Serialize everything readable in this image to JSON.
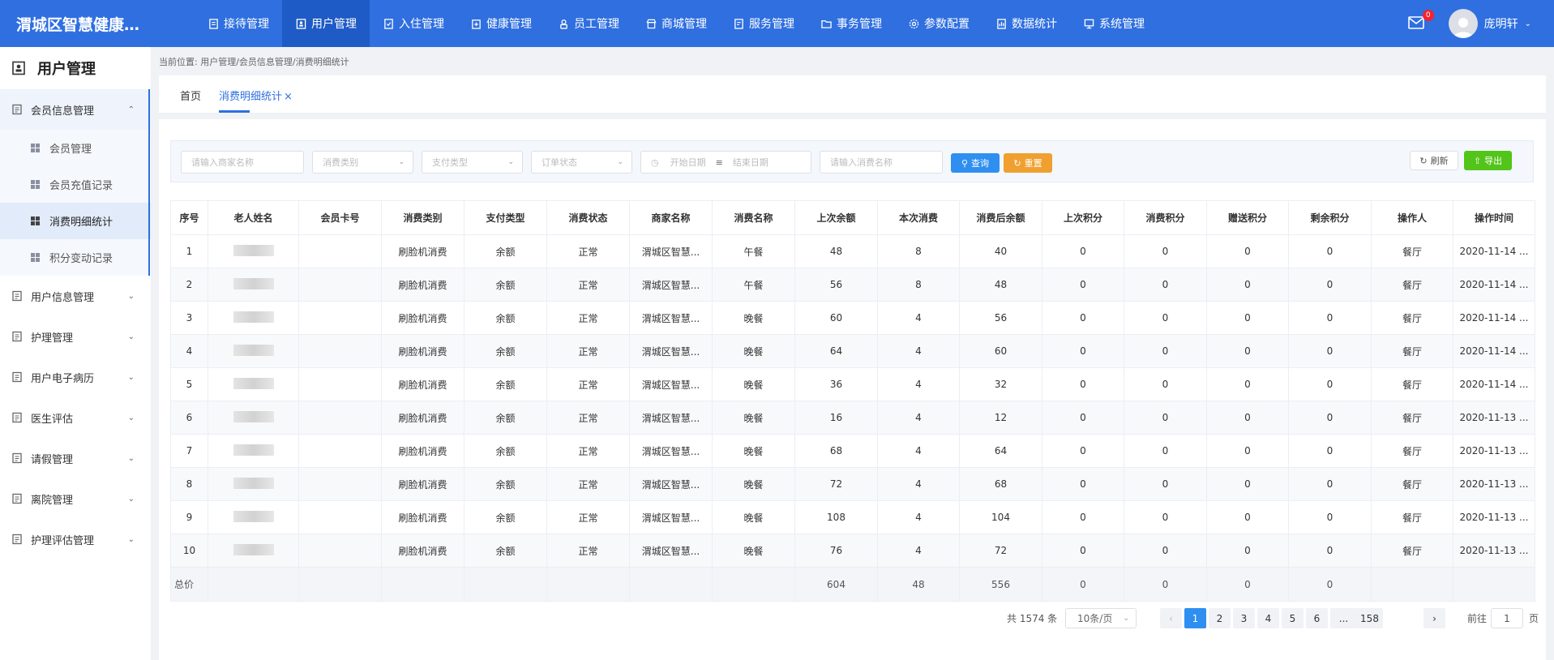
{
  "app": {
    "title": "渭城区智慧健康…"
  },
  "nav": [
    {
      "label": "接待管理",
      "icon": "reception-icon",
      "active": false
    },
    {
      "label": "用户管理",
      "icon": "user-manage-icon",
      "active": true
    },
    {
      "label": "入住管理",
      "icon": "checkin-icon",
      "active": false
    },
    {
      "label": "健康管理",
      "icon": "health-icon",
      "active": false
    },
    {
      "label": "员工管理",
      "icon": "staff-icon",
      "active": false
    },
    {
      "label": "商城管理",
      "icon": "shop-icon",
      "active": false
    },
    {
      "label": "服务管理",
      "icon": "service-icon",
      "active": false
    },
    {
      "label": "事务管理",
      "icon": "folder-icon",
      "active": false
    },
    {
      "label": "参数配置",
      "icon": "config-icon",
      "active": false
    },
    {
      "label": "数据统计",
      "icon": "stats-icon",
      "active": false
    },
    {
      "label": "系统管理",
      "icon": "system-icon",
      "active": false
    }
  ],
  "user": {
    "name": "庞明轩",
    "mail_count": "0"
  },
  "sidebar": {
    "title": "用户管理",
    "groups": [
      {
        "label": "会员信息管理",
        "open": true,
        "items": [
          {
            "label": "会员管理",
            "active": false
          },
          {
            "label": "会员充值记录",
            "active": false
          },
          {
            "label": "消费明细统计",
            "active": true
          },
          {
            "label": "积分变动记录",
            "active": false
          }
        ]
      },
      {
        "label": "用户信息管理",
        "open": false,
        "items": []
      },
      {
        "label": "护理管理",
        "open": false,
        "items": []
      },
      {
        "label": "用户电子病历",
        "open": false,
        "items": []
      },
      {
        "label": "医生评估",
        "open": false,
        "items": []
      },
      {
        "label": "请假管理",
        "open": false,
        "items": []
      },
      {
        "label": "离院管理",
        "open": false,
        "items": []
      },
      {
        "label": "护理评估管理",
        "open": false,
        "items": []
      }
    ]
  },
  "breadcrumb": "当前位置: 用户管理/会员信息管理/消费明细统计",
  "tabs": {
    "home": "首页",
    "current": "消费明细统计"
  },
  "filters": {
    "merchant_placeholder": "请输入商家名称",
    "category_placeholder": "消费类别",
    "pay_type_placeholder": "支付类型",
    "order_status_placeholder": "订单状态",
    "start_date_placeholder": "开始日期",
    "end_date_placeholder": "结束日期",
    "consume_name_placeholder": "请输入消费名称",
    "query_label": "查询",
    "reset_label": "重置",
    "refresh_label": "刷新",
    "export_label": "导出"
  },
  "table": {
    "columns": [
      "序号",
      "老人姓名",
      "会员卡号",
      "消费类别",
      "支付类型",
      "消费状态",
      "商家名称",
      "消费名称",
      "上次余额",
      "本次消费",
      "消费后余额",
      "上次积分",
      "消费积分",
      "赠送积分",
      "剩余积分",
      "操作人",
      "操作时间"
    ],
    "rows": [
      [
        "1",
        "",
        "",
        "刷脸机消费",
        "余额",
        "正常",
        "渭城区智慧...",
        "午餐",
        "48",
        "8",
        "40",
        "0",
        "0",
        "0",
        "0",
        "餐厅",
        "2020-11-14 ..."
      ],
      [
        "2",
        "",
        "",
        "刷脸机消费",
        "余额",
        "正常",
        "渭城区智慧...",
        "午餐",
        "56",
        "8",
        "48",
        "0",
        "0",
        "0",
        "0",
        "餐厅",
        "2020-11-14 ..."
      ],
      [
        "3",
        "",
        "",
        "刷脸机消费",
        "余额",
        "正常",
        "渭城区智慧...",
        "晚餐",
        "60",
        "4",
        "56",
        "0",
        "0",
        "0",
        "0",
        "餐厅",
        "2020-11-14 ..."
      ],
      [
        "4",
        "",
        "",
        "刷脸机消费",
        "余额",
        "正常",
        "渭城区智慧...",
        "晚餐",
        "64",
        "4",
        "60",
        "0",
        "0",
        "0",
        "0",
        "餐厅",
        "2020-11-14 ..."
      ],
      [
        "5",
        "",
        "",
        "刷脸机消费",
        "余额",
        "正常",
        "渭城区智慧...",
        "晚餐",
        "36",
        "4",
        "32",
        "0",
        "0",
        "0",
        "0",
        "餐厅",
        "2020-11-14 ..."
      ],
      [
        "6",
        "",
        "",
        "刷脸机消费",
        "余额",
        "正常",
        "渭城区智慧...",
        "晚餐",
        "16",
        "4",
        "12",
        "0",
        "0",
        "0",
        "0",
        "餐厅",
        "2020-11-13 ..."
      ],
      [
        "7",
        "",
        "",
        "刷脸机消费",
        "余额",
        "正常",
        "渭城区智慧...",
        "晚餐",
        "68",
        "4",
        "64",
        "0",
        "0",
        "0",
        "0",
        "餐厅",
        "2020-11-13 ..."
      ],
      [
        "8",
        "",
        "",
        "刷脸机消费",
        "余额",
        "正常",
        "渭城区智慧...",
        "晚餐",
        "72",
        "4",
        "68",
        "0",
        "0",
        "0",
        "0",
        "餐厅",
        "2020-11-13 ..."
      ],
      [
        "9",
        "",
        "",
        "刷脸机消费",
        "余额",
        "正常",
        "渭城区智慧...",
        "晚餐",
        "108",
        "4",
        "104",
        "0",
        "0",
        "0",
        "0",
        "餐厅",
        "2020-11-13 ..."
      ],
      [
        "10",
        "",
        "",
        "刷脸机消费",
        "余额",
        "正常",
        "渭城区智慧...",
        "晚餐",
        "76",
        "4",
        "72",
        "0",
        "0",
        "0",
        "0",
        "餐厅",
        "2020-11-13 ..."
      ]
    ],
    "summary": [
      "总价",
      "",
      "",
      "",
      "",
      "",
      "",
      "",
      "604",
      "48",
      "556",
      "0",
      "0",
      "0",
      "0",
      "",
      ""
    ]
  },
  "pagination": {
    "total_text": "共 1574 条",
    "page_size": "10条/页",
    "pages": [
      "1",
      "2",
      "3",
      "4",
      "5",
      "6",
      "...",
      "158"
    ],
    "current": "1",
    "goto_label": "前往",
    "goto_value": "1",
    "page_suffix": "页"
  },
  "colors": {
    "primary": "#2f6fe0",
    "query": "#2f8ff0",
    "reset": "#f0a030",
    "export": "#52c41a"
  }
}
